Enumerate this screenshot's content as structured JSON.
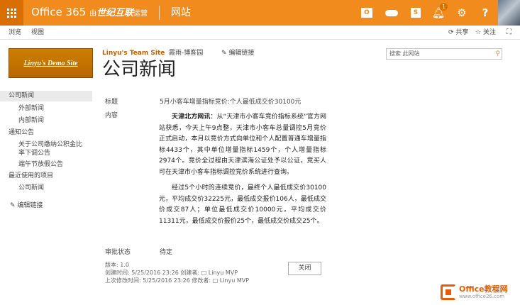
{
  "suite": {
    "brand": "Office 365",
    "brand_by": "由",
    "brand_partner": "世纪互联",
    "brand_op": "运营",
    "site_link": "网站",
    "notification_count": "1"
  },
  "ribbon": {
    "browse": "浏览",
    "view": "视图",
    "share": "共享",
    "follow": "关注"
  },
  "site": {
    "logo_text": "Linyu's Demo Site",
    "team_site": "Linyu's Team Site",
    "breadcrumb2": "霞雨-博客园",
    "edit_links": "编辑链接",
    "search_placeholder": "搜索 此网站"
  },
  "page": {
    "title": "公司新闻"
  },
  "quicklaunch": {
    "company_news": "公司新闻",
    "external_news": "外部新闻",
    "internal_news": "内部新闻",
    "notices": "通知公告",
    "notice_item1_line1": "关于公司缴纳公积金比",
    "notice_item1_line2": "率下调公告",
    "notice_item2": "端午节放假公告",
    "recent": "最近使用的项目",
    "recent_item1": "公司新闻",
    "edit_links": "编辑链接"
  },
  "form": {
    "title_label": "标题",
    "title_value": "5月小客车增量指标竞价:个人最低成交价30100元",
    "content_label": "内容",
    "content_p1_lead": "天津北方网讯",
    "content_p1_rest": "：从“天津市小客车竞价指标系统”官方网站获悉，今天上午9点整，天津市小客车总量调控5月竞价正式启动，本月以竞价方式向单位和个人配置普通车增量指标4433个，其中单位增量指标1459个，个人增量指标2974个。竞价全过程由天津滨海公证处予以公证，竞买人可在天津市小客车指标调控竞价系统进行查询。",
    "content_p2": "经过5个小时的连续竞价，最终个人最低成交价30100元，平均成交价32225元，最低成交报价106人，最低成交价成交87人；单位最低成交价10000元，平均成交价11311元，最低成交价报价25个，最低成交价成交25个。",
    "approval_label": "审批状态",
    "approval_value": "待定"
  },
  "meta": {
    "version": "版本: 1.0",
    "created": "创建时间: 5/25/2016 23:26  创建者: □ Linyu MVP",
    "modified": "上次修改时间: 5/25/2016 23:26  修改者: □ Linyu MVP",
    "close_label": "关闭"
  },
  "watermark": {
    "line1": "Office教程网",
    "line2": "www.office26.com"
  }
}
